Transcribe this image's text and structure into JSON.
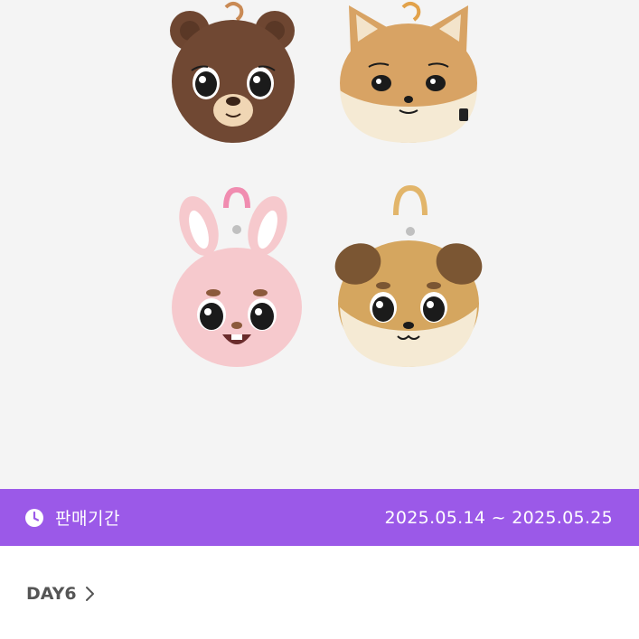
{
  "product": {
    "image_alt": "Plush face pouch keyrings: bear, fox, rabbit, puppy",
    "items": [
      {
        "name": "bear-plush",
        "color": "#6e4631"
      },
      {
        "name": "fox-plush",
        "color": "#d8a364"
      },
      {
        "name": "rabbit-plush",
        "color": "#f6c9cd"
      },
      {
        "name": "puppy-plush",
        "color": "#d5a65f"
      }
    ]
  },
  "sale_banner": {
    "icon": "clock-icon",
    "label": "판매기간",
    "period": "2025.05.14 ~ 2025.05.25",
    "background": "#9b59e8"
  },
  "artist": {
    "name": "DAY6",
    "icon": "chevron-right-icon"
  }
}
